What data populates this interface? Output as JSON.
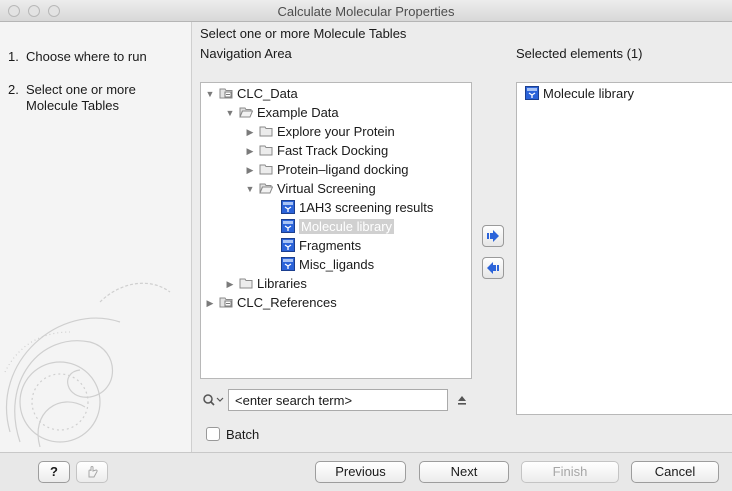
{
  "window": {
    "title": "Calculate Molecular Properties"
  },
  "steps": [
    {
      "num": "1.",
      "label": "Choose where to run"
    },
    {
      "num": "2.",
      "label": "Select one or more Molecule Tables"
    }
  ],
  "main": {
    "section_title": "Select one or more Molecule Tables",
    "navigation_label": "Navigation Area",
    "selected_label": "Selected elements (1)"
  },
  "tree": [
    {
      "label": "CLC_Data",
      "expanded": true,
      "icon": "database-icon"
    },
    {
      "label": "Example Data",
      "expanded": true,
      "icon": "folder-open-icon"
    },
    {
      "label": "Explore your Protein",
      "expanded": false,
      "icon": "folder-icon"
    },
    {
      "label": "Fast Track Docking",
      "expanded": false,
      "icon": "folder-icon"
    },
    {
      "label": "Protein–ligand docking",
      "expanded": false,
      "icon": "folder-icon"
    },
    {
      "label": "Virtual Screening",
      "expanded": true,
      "icon": "folder-open-icon"
    },
    {
      "label": "1AH3 screening results",
      "icon": "molecule-table-icon"
    },
    {
      "label": "Molecule library",
      "icon": "molecule-table-icon",
      "selected": true
    },
    {
      "label": "Fragments",
      "icon": "molecule-table-icon"
    },
    {
      "label": "Misc_ligands",
      "icon": "molecule-table-icon"
    },
    {
      "label": "Libraries",
      "expanded": false,
      "icon": "folder-icon"
    },
    {
      "label": "CLC_References",
      "expanded": false,
      "icon": "database-icon"
    }
  ],
  "selected_elements": [
    {
      "label": "Molecule library",
      "icon": "molecule-table-icon"
    }
  ],
  "search": {
    "placeholder": "<enter search term>"
  },
  "batch": {
    "label": "Batch",
    "checked": false
  },
  "footer": {
    "help_label": "?",
    "previous_label": "Previous",
    "next_label": "Next",
    "finish_label": "Finish",
    "cancel_label": "Cancel"
  },
  "colors": {
    "selection": "#d0d0d0",
    "accent_blue": "#2b63d9",
    "folder": "#c9c9c9"
  }
}
